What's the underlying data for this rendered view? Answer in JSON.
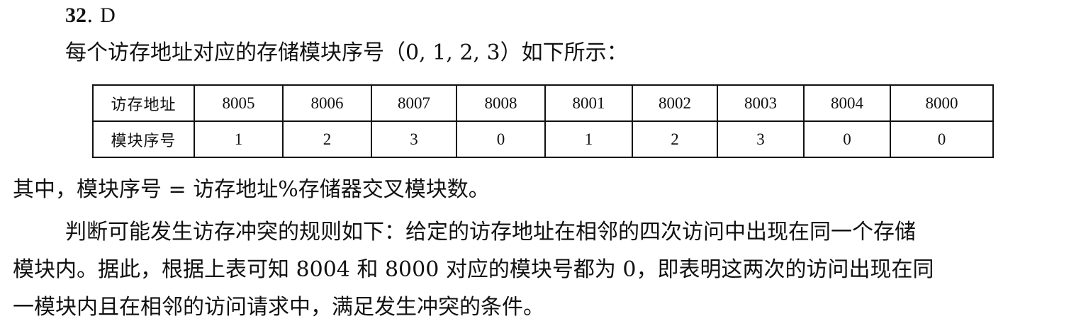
{
  "question": {
    "number": "32",
    "separator": ".",
    "answer": "D"
  },
  "intro": "每个访存地址对应的存储模块序号（0, 1, 2, 3）如下所示：",
  "table": {
    "row_headers": [
      "访存地址",
      "模块序号"
    ],
    "addresses": [
      "8005",
      "8006",
      "8007",
      "8008",
      "8001",
      "8002",
      "8003",
      "8004",
      "8000"
    ],
    "modules": [
      "1",
      "2",
      "3",
      "0",
      "1",
      "2",
      "3",
      "0",
      "0"
    ]
  },
  "formula": "其中，模块序号 = 访存地址%存储器交叉模块数。",
  "paragraph": {
    "lines": [
      "判断可能发生访存冲突的规则如下：给定的访存地址在相邻的四次访问中出现在同一个存储",
      "模块内。据此，根据上表可知 8004 和 8000 对应的模块号都为 0，即表明这两次的访问出现在同",
      "一模块内且在相邻的访问请求中，满足发生冲突的条件。"
    ]
  }
}
